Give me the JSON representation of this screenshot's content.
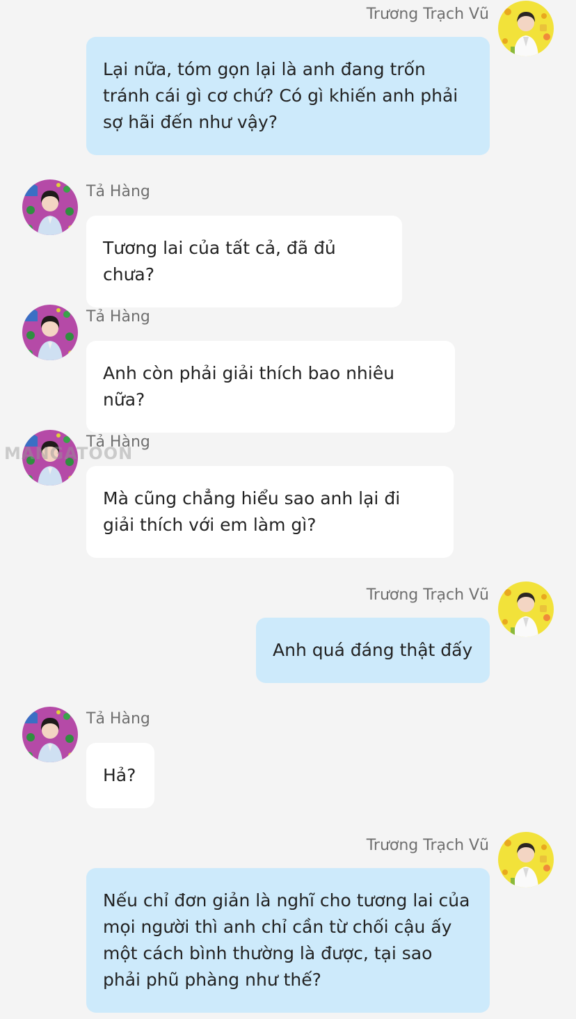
{
  "colors": {
    "background": "#f4f4f4",
    "bubble_self": "#cdeafb",
    "bubble_other": "#ffffff",
    "name_text": "#6f6f6f",
    "message_text": "#222222"
  },
  "watermark": "MANGATOON",
  "messages": [
    {
      "side": "right",
      "sender": "Trương Trạch Vũ",
      "text": "Lại nữa, tóm gọn lại là anh đang trốn tránh cái gì cơ chứ? Có gì khiến anh phải sợ hãi đến như vậy?"
    },
    {
      "side": "left",
      "sender": "Tả Hàng",
      "text": "Tương lai của tất cả, đã đủ chưa?"
    },
    {
      "side": "left",
      "sender": "Tả Hàng",
      "text": "Anh còn phải giải thích bao nhiêu nữa?"
    },
    {
      "side": "left",
      "sender": "Tả Hàng",
      "text": "Mà cũng chẳng hiểu sao anh lại đi giải thích với em làm gì?"
    },
    {
      "side": "right",
      "sender": "Trương Trạch Vũ",
      "text": "Anh quá đáng thật đấy"
    },
    {
      "side": "left",
      "sender": "Tả Hàng",
      "text": "Hả?"
    },
    {
      "side": "right",
      "sender": "Trương Trạch Vũ",
      "text": "Nếu chỉ đơn giản là nghĩ cho tương lai của mọi người thì anh chỉ cần từ chối cậu ấy một cách bình thường là được, tại sao phải phũ phàng như thế?"
    }
  ]
}
